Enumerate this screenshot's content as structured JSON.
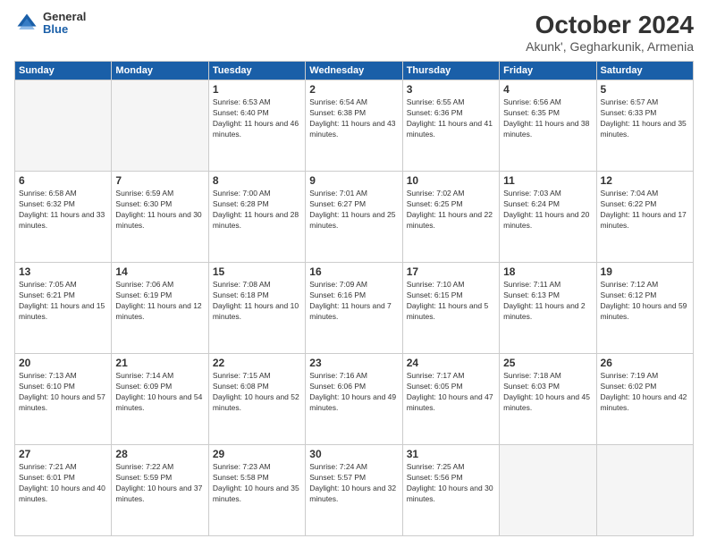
{
  "logo": {
    "general": "General",
    "blue": "Blue"
  },
  "header": {
    "month": "October 2024",
    "location": "Akunk', Gegharkunik, Armenia"
  },
  "weekdays": [
    "Sunday",
    "Monday",
    "Tuesday",
    "Wednesday",
    "Thursday",
    "Friday",
    "Saturday"
  ],
  "weeks": [
    [
      {
        "day": "",
        "empty": true
      },
      {
        "day": "",
        "empty": true
      },
      {
        "day": "1",
        "sunrise": "6:53 AM",
        "sunset": "6:40 PM",
        "daylight": "11 hours and 46 minutes."
      },
      {
        "day": "2",
        "sunrise": "6:54 AM",
        "sunset": "6:38 PM",
        "daylight": "11 hours and 43 minutes."
      },
      {
        "day": "3",
        "sunrise": "6:55 AM",
        "sunset": "6:36 PM",
        "daylight": "11 hours and 41 minutes."
      },
      {
        "day": "4",
        "sunrise": "6:56 AM",
        "sunset": "6:35 PM",
        "daylight": "11 hours and 38 minutes."
      },
      {
        "day": "5",
        "sunrise": "6:57 AM",
        "sunset": "6:33 PM",
        "daylight": "11 hours and 35 minutes."
      }
    ],
    [
      {
        "day": "6",
        "sunrise": "6:58 AM",
        "sunset": "6:32 PM",
        "daylight": "11 hours and 33 minutes."
      },
      {
        "day": "7",
        "sunrise": "6:59 AM",
        "sunset": "6:30 PM",
        "daylight": "11 hours and 30 minutes."
      },
      {
        "day": "8",
        "sunrise": "7:00 AM",
        "sunset": "6:28 PM",
        "daylight": "11 hours and 28 minutes."
      },
      {
        "day": "9",
        "sunrise": "7:01 AM",
        "sunset": "6:27 PM",
        "daylight": "11 hours and 25 minutes."
      },
      {
        "day": "10",
        "sunrise": "7:02 AM",
        "sunset": "6:25 PM",
        "daylight": "11 hours and 22 minutes."
      },
      {
        "day": "11",
        "sunrise": "7:03 AM",
        "sunset": "6:24 PM",
        "daylight": "11 hours and 20 minutes."
      },
      {
        "day": "12",
        "sunrise": "7:04 AM",
        "sunset": "6:22 PM",
        "daylight": "11 hours and 17 minutes."
      }
    ],
    [
      {
        "day": "13",
        "sunrise": "7:05 AM",
        "sunset": "6:21 PM",
        "daylight": "11 hours and 15 minutes."
      },
      {
        "day": "14",
        "sunrise": "7:06 AM",
        "sunset": "6:19 PM",
        "daylight": "11 hours and 12 minutes."
      },
      {
        "day": "15",
        "sunrise": "7:08 AM",
        "sunset": "6:18 PM",
        "daylight": "11 hours and 10 minutes."
      },
      {
        "day": "16",
        "sunrise": "7:09 AM",
        "sunset": "6:16 PM",
        "daylight": "11 hours and 7 minutes."
      },
      {
        "day": "17",
        "sunrise": "7:10 AM",
        "sunset": "6:15 PM",
        "daylight": "11 hours and 5 minutes."
      },
      {
        "day": "18",
        "sunrise": "7:11 AM",
        "sunset": "6:13 PM",
        "daylight": "11 hours and 2 minutes."
      },
      {
        "day": "19",
        "sunrise": "7:12 AM",
        "sunset": "6:12 PM",
        "daylight": "10 hours and 59 minutes."
      }
    ],
    [
      {
        "day": "20",
        "sunrise": "7:13 AM",
        "sunset": "6:10 PM",
        "daylight": "10 hours and 57 minutes."
      },
      {
        "day": "21",
        "sunrise": "7:14 AM",
        "sunset": "6:09 PM",
        "daylight": "10 hours and 54 minutes."
      },
      {
        "day": "22",
        "sunrise": "7:15 AM",
        "sunset": "6:08 PM",
        "daylight": "10 hours and 52 minutes."
      },
      {
        "day": "23",
        "sunrise": "7:16 AM",
        "sunset": "6:06 PM",
        "daylight": "10 hours and 49 minutes."
      },
      {
        "day": "24",
        "sunrise": "7:17 AM",
        "sunset": "6:05 PM",
        "daylight": "10 hours and 47 minutes."
      },
      {
        "day": "25",
        "sunrise": "7:18 AM",
        "sunset": "6:03 PM",
        "daylight": "10 hours and 45 minutes."
      },
      {
        "day": "26",
        "sunrise": "7:19 AM",
        "sunset": "6:02 PM",
        "daylight": "10 hours and 42 minutes."
      }
    ],
    [
      {
        "day": "27",
        "sunrise": "7:21 AM",
        "sunset": "6:01 PM",
        "daylight": "10 hours and 40 minutes."
      },
      {
        "day": "28",
        "sunrise": "7:22 AM",
        "sunset": "5:59 PM",
        "daylight": "10 hours and 37 minutes."
      },
      {
        "day": "29",
        "sunrise": "7:23 AM",
        "sunset": "5:58 PM",
        "daylight": "10 hours and 35 minutes."
      },
      {
        "day": "30",
        "sunrise": "7:24 AM",
        "sunset": "5:57 PM",
        "daylight": "10 hours and 32 minutes."
      },
      {
        "day": "31",
        "sunrise": "7:25 AM",
        "sunset": "5:56 PM",
        "daylight": "10 hours and 30 minutes."
      },
      {
        "day": "",
        "empty": true
      },
      {
        "day": "",
        "empty": true
      }
    ]
  ]
}
